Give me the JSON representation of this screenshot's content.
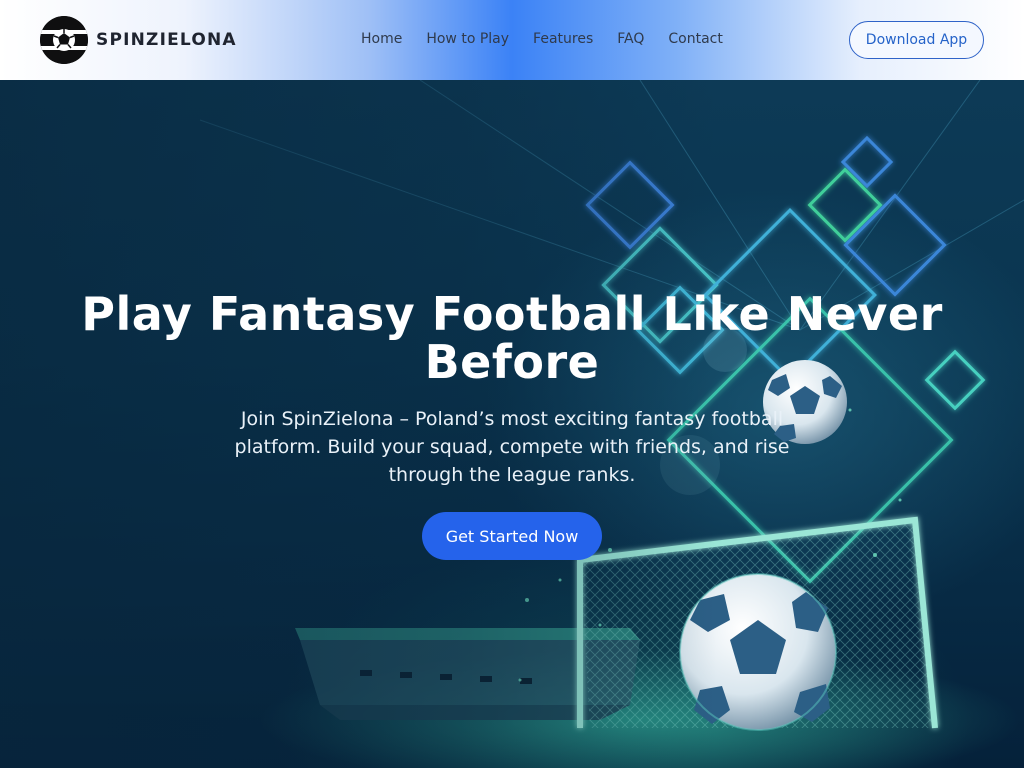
{
  "header": {
    "brand_name": "SPINZIELONA",
    "nav_items": [
      "Home",
      "How to Play",
      "Features",
      "FAQ",
      "Contact"
    ],
    "download_label": "Download App"
  },
  "hero": {
    "title": "Play Fantasy Football Like Never Before",
    "subtitle": "Join SpinZielona – Poland’s most exciting fantasy football platform. Build your squad, compete with friends, and rise through the league ranks.",
    "cta_label": "Get Started Now"
  },
  "colors": {
    "accent": "#2563eb",
    "header_gradient_center": "#3b82f6",
    "hero_background": "#0a3550"
  },
  "icons": {
    "logo": "football-icon"
  }
}
